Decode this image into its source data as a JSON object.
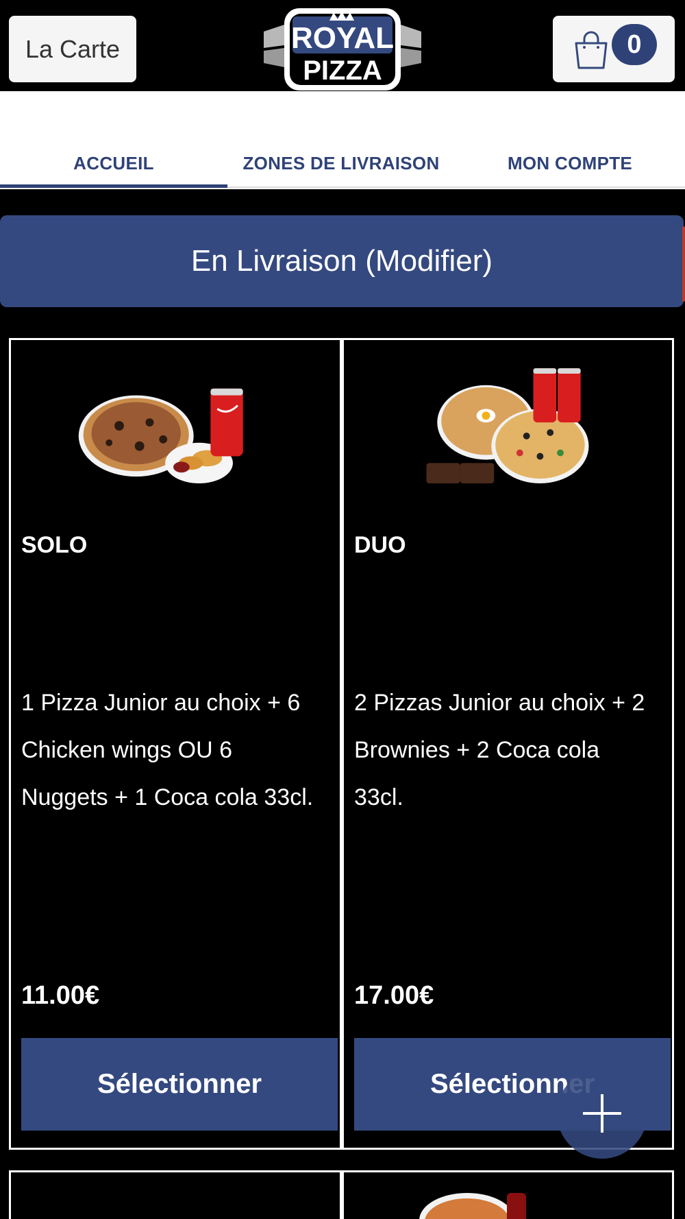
{
  "header": {
    "menu_button_label": "La Carte",
    "logo_text_top": "ROYAL",
    "logo_text_bottom": "PIZZA",
    "cart_count": "0"
  },
  "tabs": [
    {
      "label": "ACCUEIL",
      "active": true
    },
    {
      "label": "ZONES DE LIVRAISON",
      "active": false
    },
    {
      "label": "MON COMPTE",
      "active": false
    }
  ],
  "delivery_bar": {
    "label": "En Livraison (Modifier)"
  },
  "products": [
    {
      "title": "SOLO",
      "description_lines": [
        "1 Pizza Junior au choix  + 6",
        "Chicken wings OU 6",
        "Nuggets  + 1 Coca cola 33cl."
      ],
      "price": "11.00€",
      "button_label": "Sélectionner"
    },
    {
      "title": "DUO",
      "description_lines": [
        "2 Pizzas Junior au choix  + 2",
        "Brownies  + 2 Coca cola",
        "33cl."
      ],
      "price": "17.00€",
      "button_label": "Sélectionner"
    }
  ],
  "colors": {
    "brand_blue": "#34497f",
    "tab_text": "#2f4278",
    "background": "#000000"
  },
  "icons": {
    "cart": "shopping-bag-icon",
    "fab": "plus-icon"
  }
}
